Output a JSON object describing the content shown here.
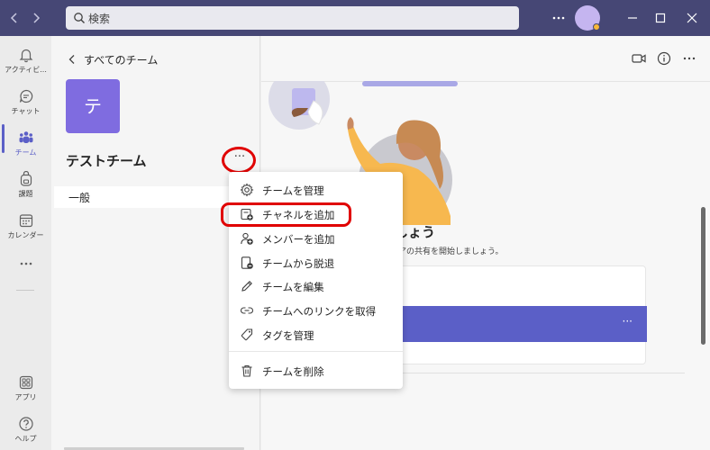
{
  "titlebar": {
    "search_placeholder": "検索",
    "more_label": "···"
  },
  "rail": {
    "items": [
      {
        "label": "アクティビ...",
        "icon": "bell-icon"
      },
      {
        "label": "チャット",
        "icon": "chat-icon"
      },
      {
        "label": "チーム",
        "icon": "teams-icon"
      },
      {
        "label": "課題",
        "icon": "backpack-icon"
      },
      {
        "label": "カレンダー",
        "icon": "calendar-icon"
      },
      {
        "label": "···",
        "icon": "more-icon"
      },
      {
        "label": "アプリ",
        "icon": "apps-icon"
      },
      {
        "label": "ヘルプ",
        "icon": "help-icon"
      }
    ],
    "active_index": 2
  },
  "panel": {
    "back_label": "すべてのチーム",
    "team_initial": "テ",
    "team_name": "テストチーム",
    "more_label": "···",
    "channels": [
      "一般"
    ]
  },
  "main": {
    "welcome_title": "しょう",
    "welcome_subtitle": "アの共有を開始しましょう。",
    "card_more": "···"
  },
  "menu": {
    "items": [
      {
        "label": "チームを管理",
        "icon": "gear-icon"
      },
      {
        "label": "チャネルを追加",
        "icon": "add-channel-icon"
      },
      {
        "label": "メンバーを追加",
        "icon": "add-member-icon"
      },
      {
        "label": "チームから脱退",
        "icon": "leave-icon"
      },
      {
        "label": "チームを編集",
        "icon": "pencil-icon"
      },
      {
        "label": "チームへのリンクを取得",
        "icon": "link-icon"
      },
      {
        "label": "タグを管理",
        "icon": "tag-icon"
      },
      {
        "label": "チームを削除",
        "icon": "trash-icon"
      }
    ]
  },
  "colors": {
    "titlebar": "#464775",
    "accent": "#5b5fc7",
    "team_tile": "#7f6ce0",
    "highlight": "#e00000"
  }
}
